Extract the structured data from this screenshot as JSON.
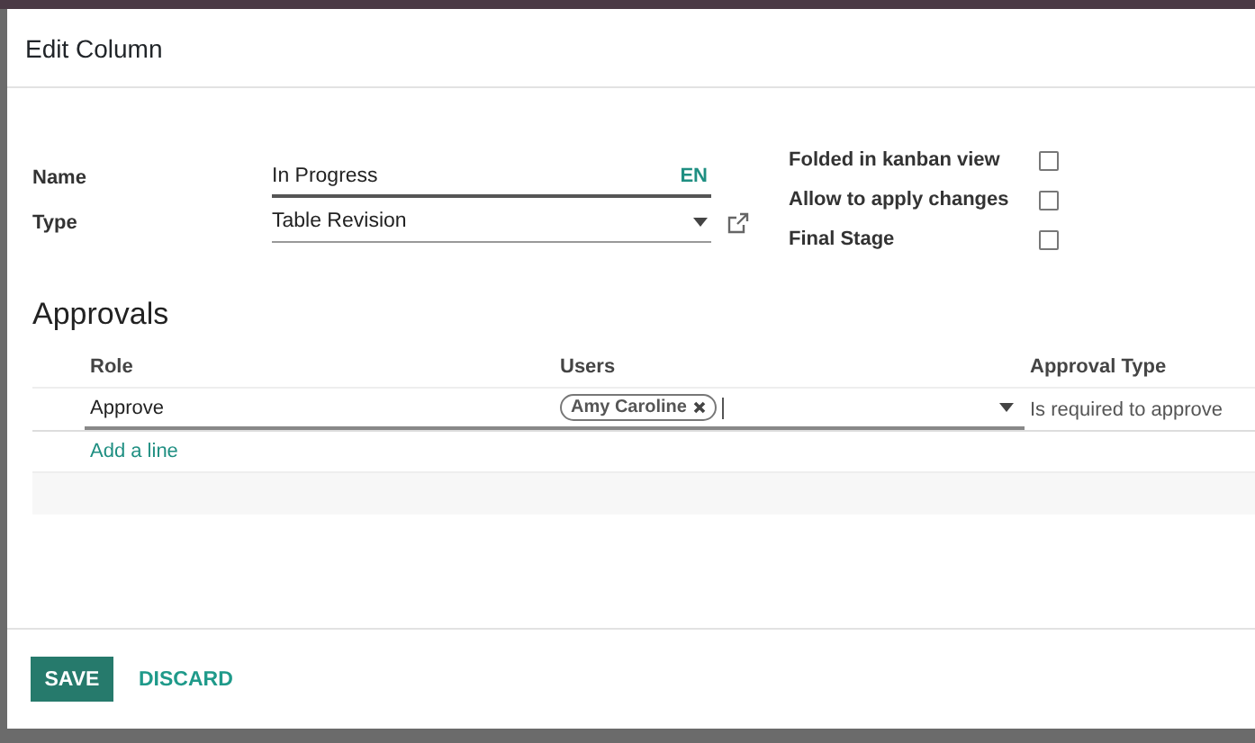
{
  "dialog": {
    "title": "Edit Column"
  },
  "fields": [
    {
      "label": "Name",
      "kind": "text",
      "value": "In Progress",
      "lang": "EN"
    },
    {
      "label": "Type",
      "kind": "select",
      "value": "Table Revision"
    }
  ],
  "options": [
    {
      "label": "Folded in kanban view",
      "checked": false
    },
    {
      "label": "Allow to apply changes",
      "checked": false
    },
    {
      "label": "Final Stage",
      "checked": false
    }
  ],
  "approvals": {
    "title": "Approvals",
    "columns": [
      "Role",
      "Users",
      "Approval Type"
    ],
    "rows": [
      {
        "role": "Approve",
        "users": [
          "Amy Caroline"
        ],
        "approval_type": "Is required to approve"
      }
    ],
    "add_line": "Add a line"
  },
  "buttons": [
    {
      "label": "SAVE",
      "kind": "primary"
    },
    {
      "label": "DISCARD",
      "kind": "link"
    }
  ]
}
